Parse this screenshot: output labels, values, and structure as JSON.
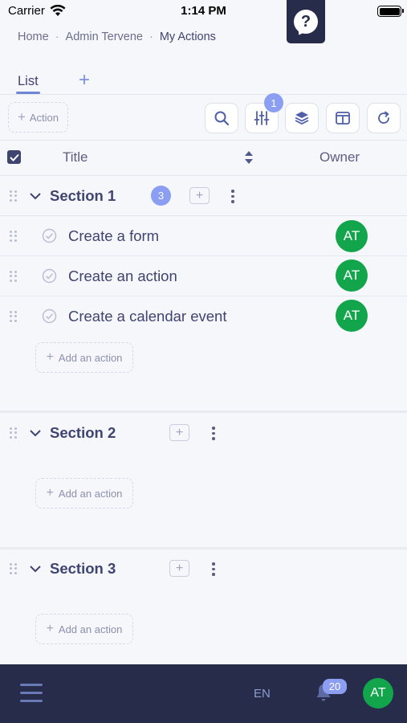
{
  "status_bar": {
    "carrier": "Carrier",
    "time": "1:14 PM"
  },
  "help": {
    "icon": "?"
  },
  "breadcrumb": {
    "items": [
      "Home",
      "Admin Tervene",
      "My Actions"
    ]
  },
  "tabs": {
    "list_label": "List",
    "add_icon": "+"
  },
  "toolbar": {
    "add_action_label": "Action",
    "filter_badge": "1"
  },
  "table_header": {
    "title": "Title",
    "owner": "Owner"
  },
  "sections": [
    {
      "title": "Section 1",
      "count": "3",
      "items": [
        {
          "title": "Create a form",
          "owner": "AT"
        },
        {
          "title": "Create an action",
          "owner": "AT"
        },
        {
          "title": "Create a calendar event",
          "owner": "AT"
        }
      ],
      "add_label": "Add an action"
    },
    {
      "title": "Section 2",
      "items": [],
      "add_label": "Add an action"
    },
    {
      "title": "Section 3",
      "items": [],
      "add_label": "Add an action"
    }
  ],
  "footer": {
    "language": "EN",
    "notifications": "20",
    "user_initials": "AT"
  },
  "colors": {
    "accent": "#8c9ef1",
    "nav_dark": "#262c49",
    "avatar_green": "#12a54b",
    "text": "#3f4470"
  }
}
